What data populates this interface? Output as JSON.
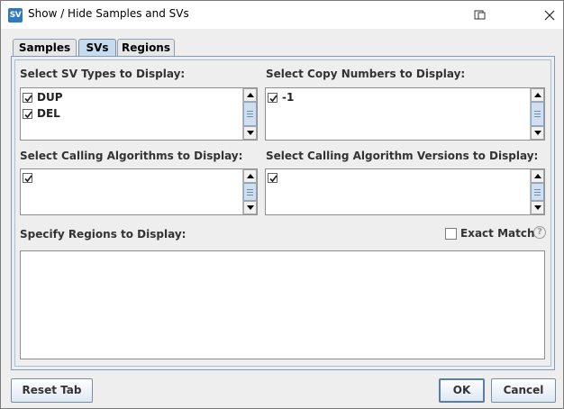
{
  "window": {
    "title": "Show / Hide Samples and SVs",
    "icon_text": "SV"
  },
  "tabs": [
    {
      "label": "Samples",
      "active": false
    },
    {
      "label": "SVs",
      "active": true
    },
    {
      "label": "Regions",
      "active": false
    }
  ],
  "sections": {
    "sv_types": {
      "label": "Select SV Types to Display:",
      "items": [
        {
          "label": "DUP",
          "checked": true
        },
        {
          "label": "DEL",
          "checked": true
        }
      ]
    },
    "copy_numbers": {
      "label": "Select Copy Numbers to Display:",
      "items": [
        {
          "label": "-1",
          "checked": true
        }
      ]
    },
    "calling_algorithms": {
      "label": "Select Calling Algorithms to Display:",
      "items": [
        {
          "label": "",
          "checked": true
        }
      ]
    },
    "calling_algorithm_versions": {
      "label": "Select Calling Algorithm Versions to Display:",
      "items": [
        {
          "label": "",
          "checked": true
        }
      ]
    },
    "regions": {
      "label": "Specify Regions to Display:",
      "value": "",
      "exact_match_label": "Exact Match",
      "exact_match_checked": false,
      "help_glyph": "?"
    }
  },
  "buttons": {
    "reset_tab": "Reset Tab",
    "ok": "OK",
    "cancel": "Cancel"
  },
  "icons": {
    "app": "sv-app-icon",
    "restore": "restore-window-icon",
    "close": "close-icon",
    "help": "help-icon"
  },
  "colors": {
    "window_bg": "#eeeeee",
    "active_tab": "#c7dbee",
    "panel_border": "#7f9db9",
    "app_icon": "#2f78c4"
  }
}
